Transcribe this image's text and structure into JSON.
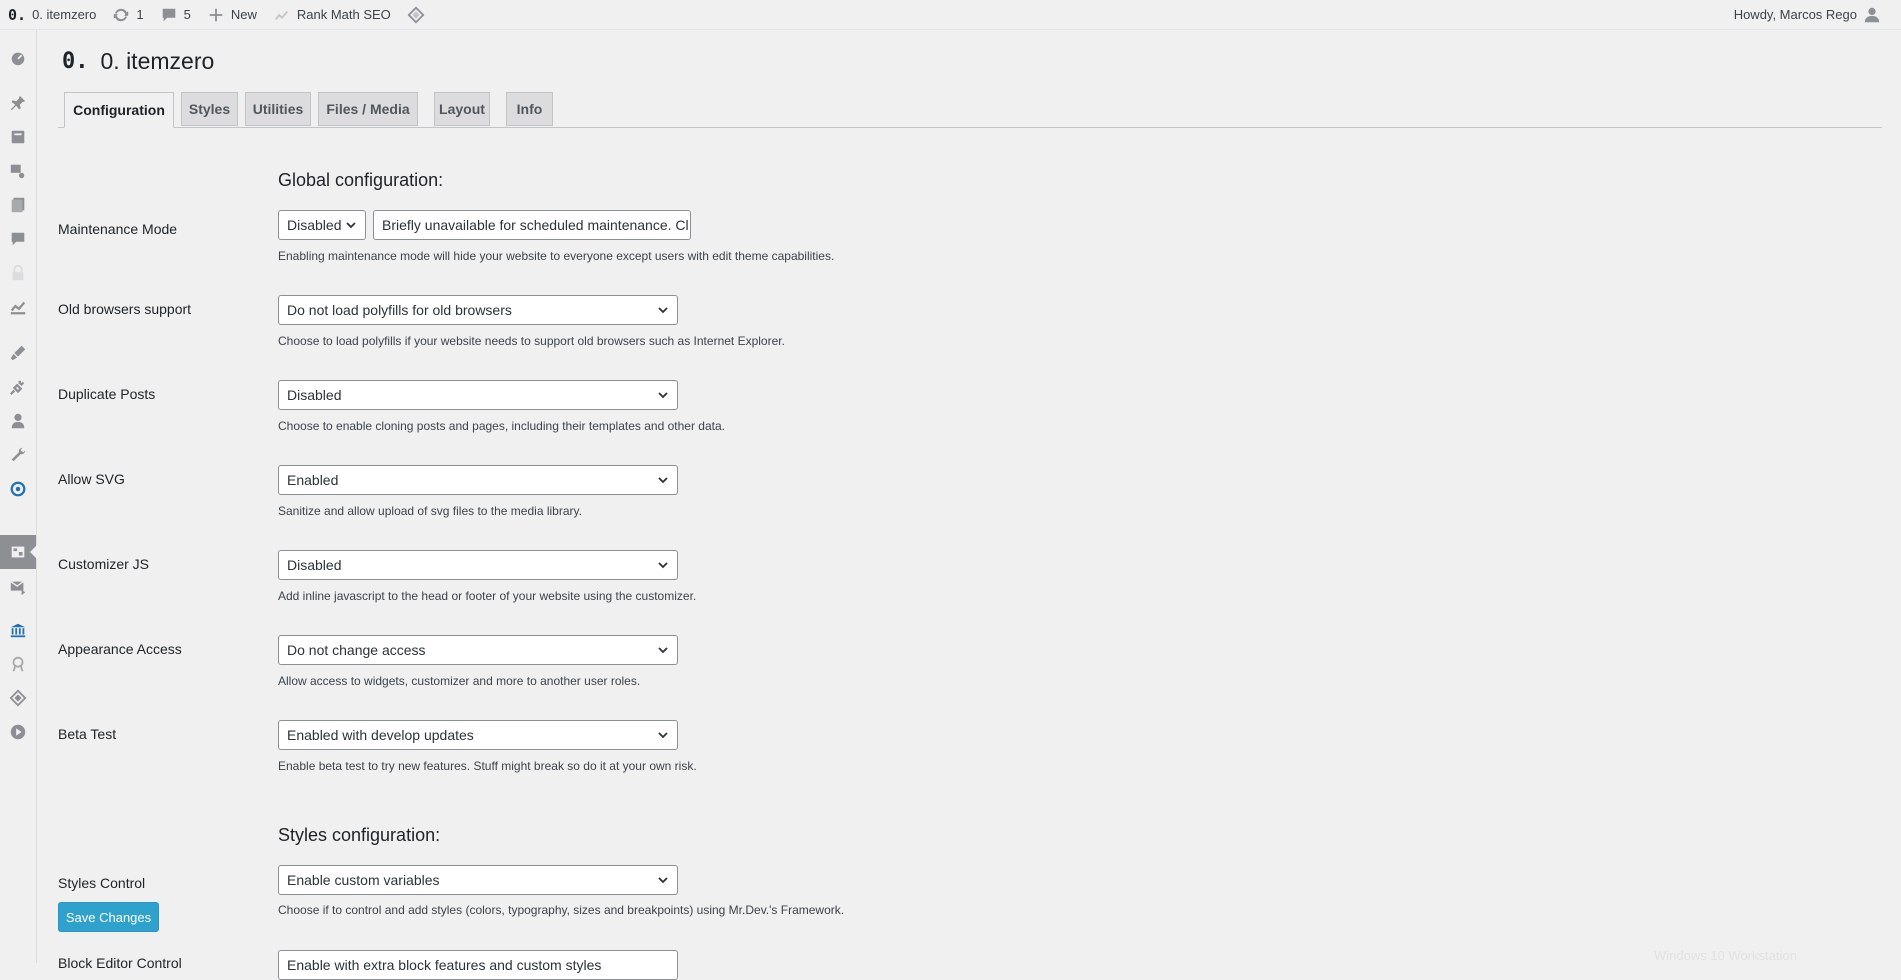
{
  "admin_bar": {
    "site_logo": "0.",
    "site_name": "0. itemzero",
    "updates_count": "1",
    "comments_count": "5",
    "new_label": "New",
    "rank_math_label": "Rank Math SEO",
    "greeting": "Howdy, Marcos Rego"
  },
  "header": {
    "logo": "0.",
    "title": "0. itemzero"
  },
  "tabs": [
    {
      "label": "Configuration",
      "active": true
    },
    {
      "label": "Styles"
    },
    {
      "label": "Utilities"
    },
    {
      "label": "Files / Media"
    },
    {
      "label": "Layout"
    },
    {
      "label": "Info"
    }
  ],
  "sections": {
    "global_title": "Global configuration:",
    "styles_title": "Styles configuration:"
  },
  "settings": {
    "maintenance": {
      "label": "Maintenance Mode",
      "value": "Disabled",
      "message_value": "Briefly unavailable for scheduled maintenance. Cl",
      "description": "Enabling maintenance mode will hide your website to everyone except users with edit theme capabilities."
    },
    "old_browsers": {
      "label": "Old browsers support",
      "value": "Do not load polyfills for old browsers",
      "description": "Choose to load polyfills if your website needs to support old browsers such as Internet Explorer."
    },
    "duplicate_posts": {
      "label": "Duplicate Posts",
      "value": "Disabled",
      "description": "Choose to enable cloning posts and pages, including their templates and other data."
    },
    "allow_svg": {
      "label": "Allow SVG",
      "value": "Enabled",
      "description": "Sanitize and allow upload of svg files to the media library."
    },
    "customizer_js": {
      "label": "Customizer JS",
      "value": "Disabled",
      "description": "Add inline javascript to the head or footer of your website using the customizer."
    },
    "appearance_access": {
      "label": "Appearance Access",
      "value": "Do not change access",
      "description": "Allow access to widgets, customizer and more to another user roles."
    },
    "beta_test": {
      "label": "Beta Test",
      "value": "Enabled with develop updates",
      "description": "Enable beta test to try new features. Stuff might break so do it at your own risk."
    },
    "styles_control": {
      "label": "Styles Control",
      "value": "Enable custom variables",
      "description": "Choose if to control and add styles (colors, typography, sizes and breakpoints) using Mr.Dev.'s Framework."
    },
    "block_editor_control": {
      "label": "Block Editor Control",
      "value": "Enable with extra block features and custom styles"
    }
  },
  "actions": {
    "save_label": "Save Changes"
  },
  "watermark": "Windows 10 Workstation",
  "colors": {
    "accent": "#2ea2cc",
    "background": "#f0f0f1",
    "menu_current": "#8c8f94"
  },
  "side_menu_icons": [
    "dashboard-icon",
    "posts-icon",
    "book-icon",
    "media-icon",
    "pages-icon",
    "comments-icon",
    "lock-icon",
    "chart-icon",
    "appearance-icon",
    "plugins-icon",
    "users-icon",
    "tools-icon",
    "sync-icon",
    "settings-panel-icon",
    "mail-icon",
    "library-icon",
    "ribbon-icon",
    "diamond-icon",
    "play-icon"
  ]
}
